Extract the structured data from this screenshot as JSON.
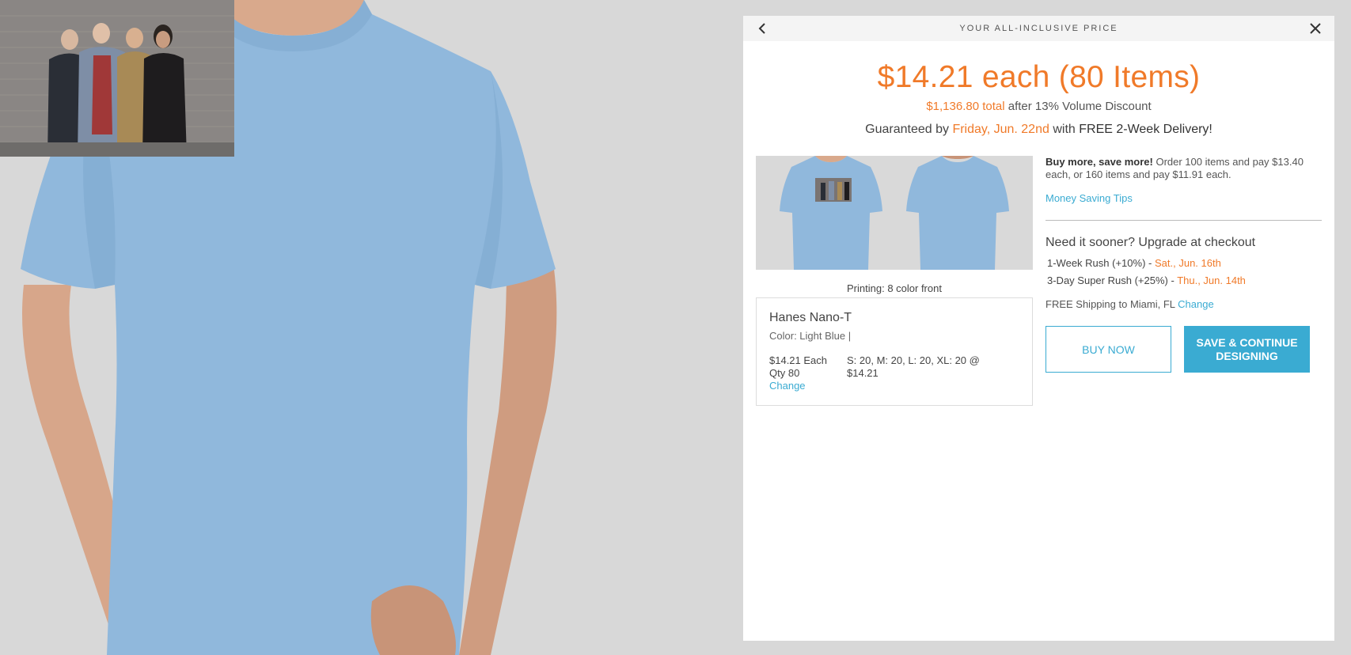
{
  "preview": {
    "shirt_color": "#90b8dc",
    "photo_alt": "band-photo"
  },
  "panel": {
    "title": "YOUR ALL-INCLUSIVE PRICE",
    "price_headline": "$14.21 each (80 Items)",
    "total_amount": "$1,136.80 total",
    "total_suffix": "after 13% Volume Discount",
    "delivery_prefix": "Guaranteed by",
    "delivery_date": "Friday, Jun. 22nd",
    "delivery_mid": "with",
    "delivery_bold": "FREE 2-Week Delivery!",
    "printing": "Printing: 8 color front",
    "product": {
      "name": "Hanes Nano-T",
      "color": "Color: Light Blue |",
      "price_each": "$14.21 Each",
      "qty": "Qty 80",
      "change": "Change",
      "sizes": "S: 20, M: 20, L: 20, XL: 20 @",
      "sizes_price": "$14.21"
    },
    "buy_more_bold": "Buy more, save more!",
    "buy_more_text": "Order 100 items and pay $13.40 each, or 160 items and pay $11.91 each.",
    "money_tips": "Money Saving Tips",
    "sooner": "Need it sooner? Upgrade at checkout",
    "rush1_label": "1-Week Rush",
    "rush1_pct": "(+10%) -",
    "rush1_date": "Sat., Jun. 16th",
    "rush2_label": "3-Day Super Rush",
    "rush2_pct": "(+25%) -",
    "rush2_date": "Thu., Jun. 14th",
    "shipping": "FREE Shipping to Miami, FL",
    "shipping_change": "Change",
    "buy_now": "BUY NOW",
    "save_continue": "SAVE & CONTINUE DESIGNING"
  },
  "colors": {
    "accent_orange": "#f07a29",
    "accent_blue": "#3aabd2"
  }
}
